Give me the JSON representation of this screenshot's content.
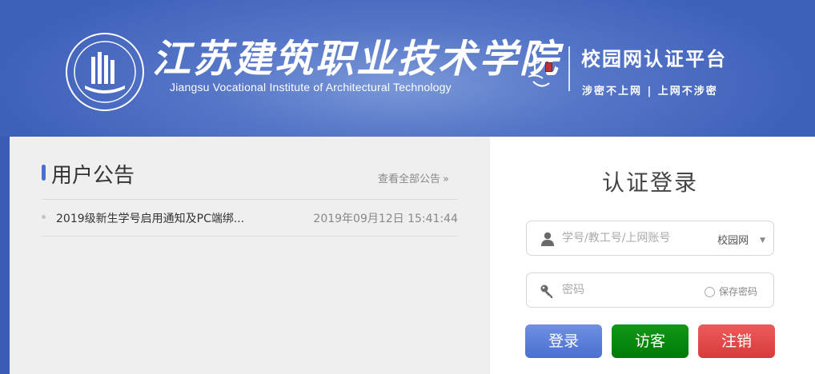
{
  "banner": {
    "school_name_cn": "江苏建筑职业技术学院",
    "school_name_en": "Jiangsu Vocational Institute of Architectural Technology",
    "platform_title": "校园网认证平台",
    "slogan": "涉密不上网 | 上网不涉密",
    "seal_icon": "school-seal-icon"
  },
  "notice": {
    "title": "用户公告",
    "view_all": "查看全部公告",
    "view_all_icon": "double-chevron-right-icon",
    "items": [
      {
        "text": "2019级新生学号启用通知及PC端绑...",
        "time": "2019年09月12日 15:41:44"
      }
    ]
  },
  "login": {
    "title": "认证登录",
    "username_placeholder": "学号/教工号/上网账号",
    "username_icon": "user-icon",
    "network_selected": "校园网",
    "password_placeholder": "密码",
    "password_icon": "key-icon",
    "remember_label": "保存密码",
    "login_button": "登录",
    "guest_button": "访客",
    "logout_button": "注销"
  },
  "colors": {
    "background": "#3a5cb4",
    "accent": "#4a6fcc",
    "login_button": "#5a7ed8",
    "guest_button": "#0a8a10",
    "logout_button": "#e04848",
    "notice_panel": "#efefef"
  }
}
